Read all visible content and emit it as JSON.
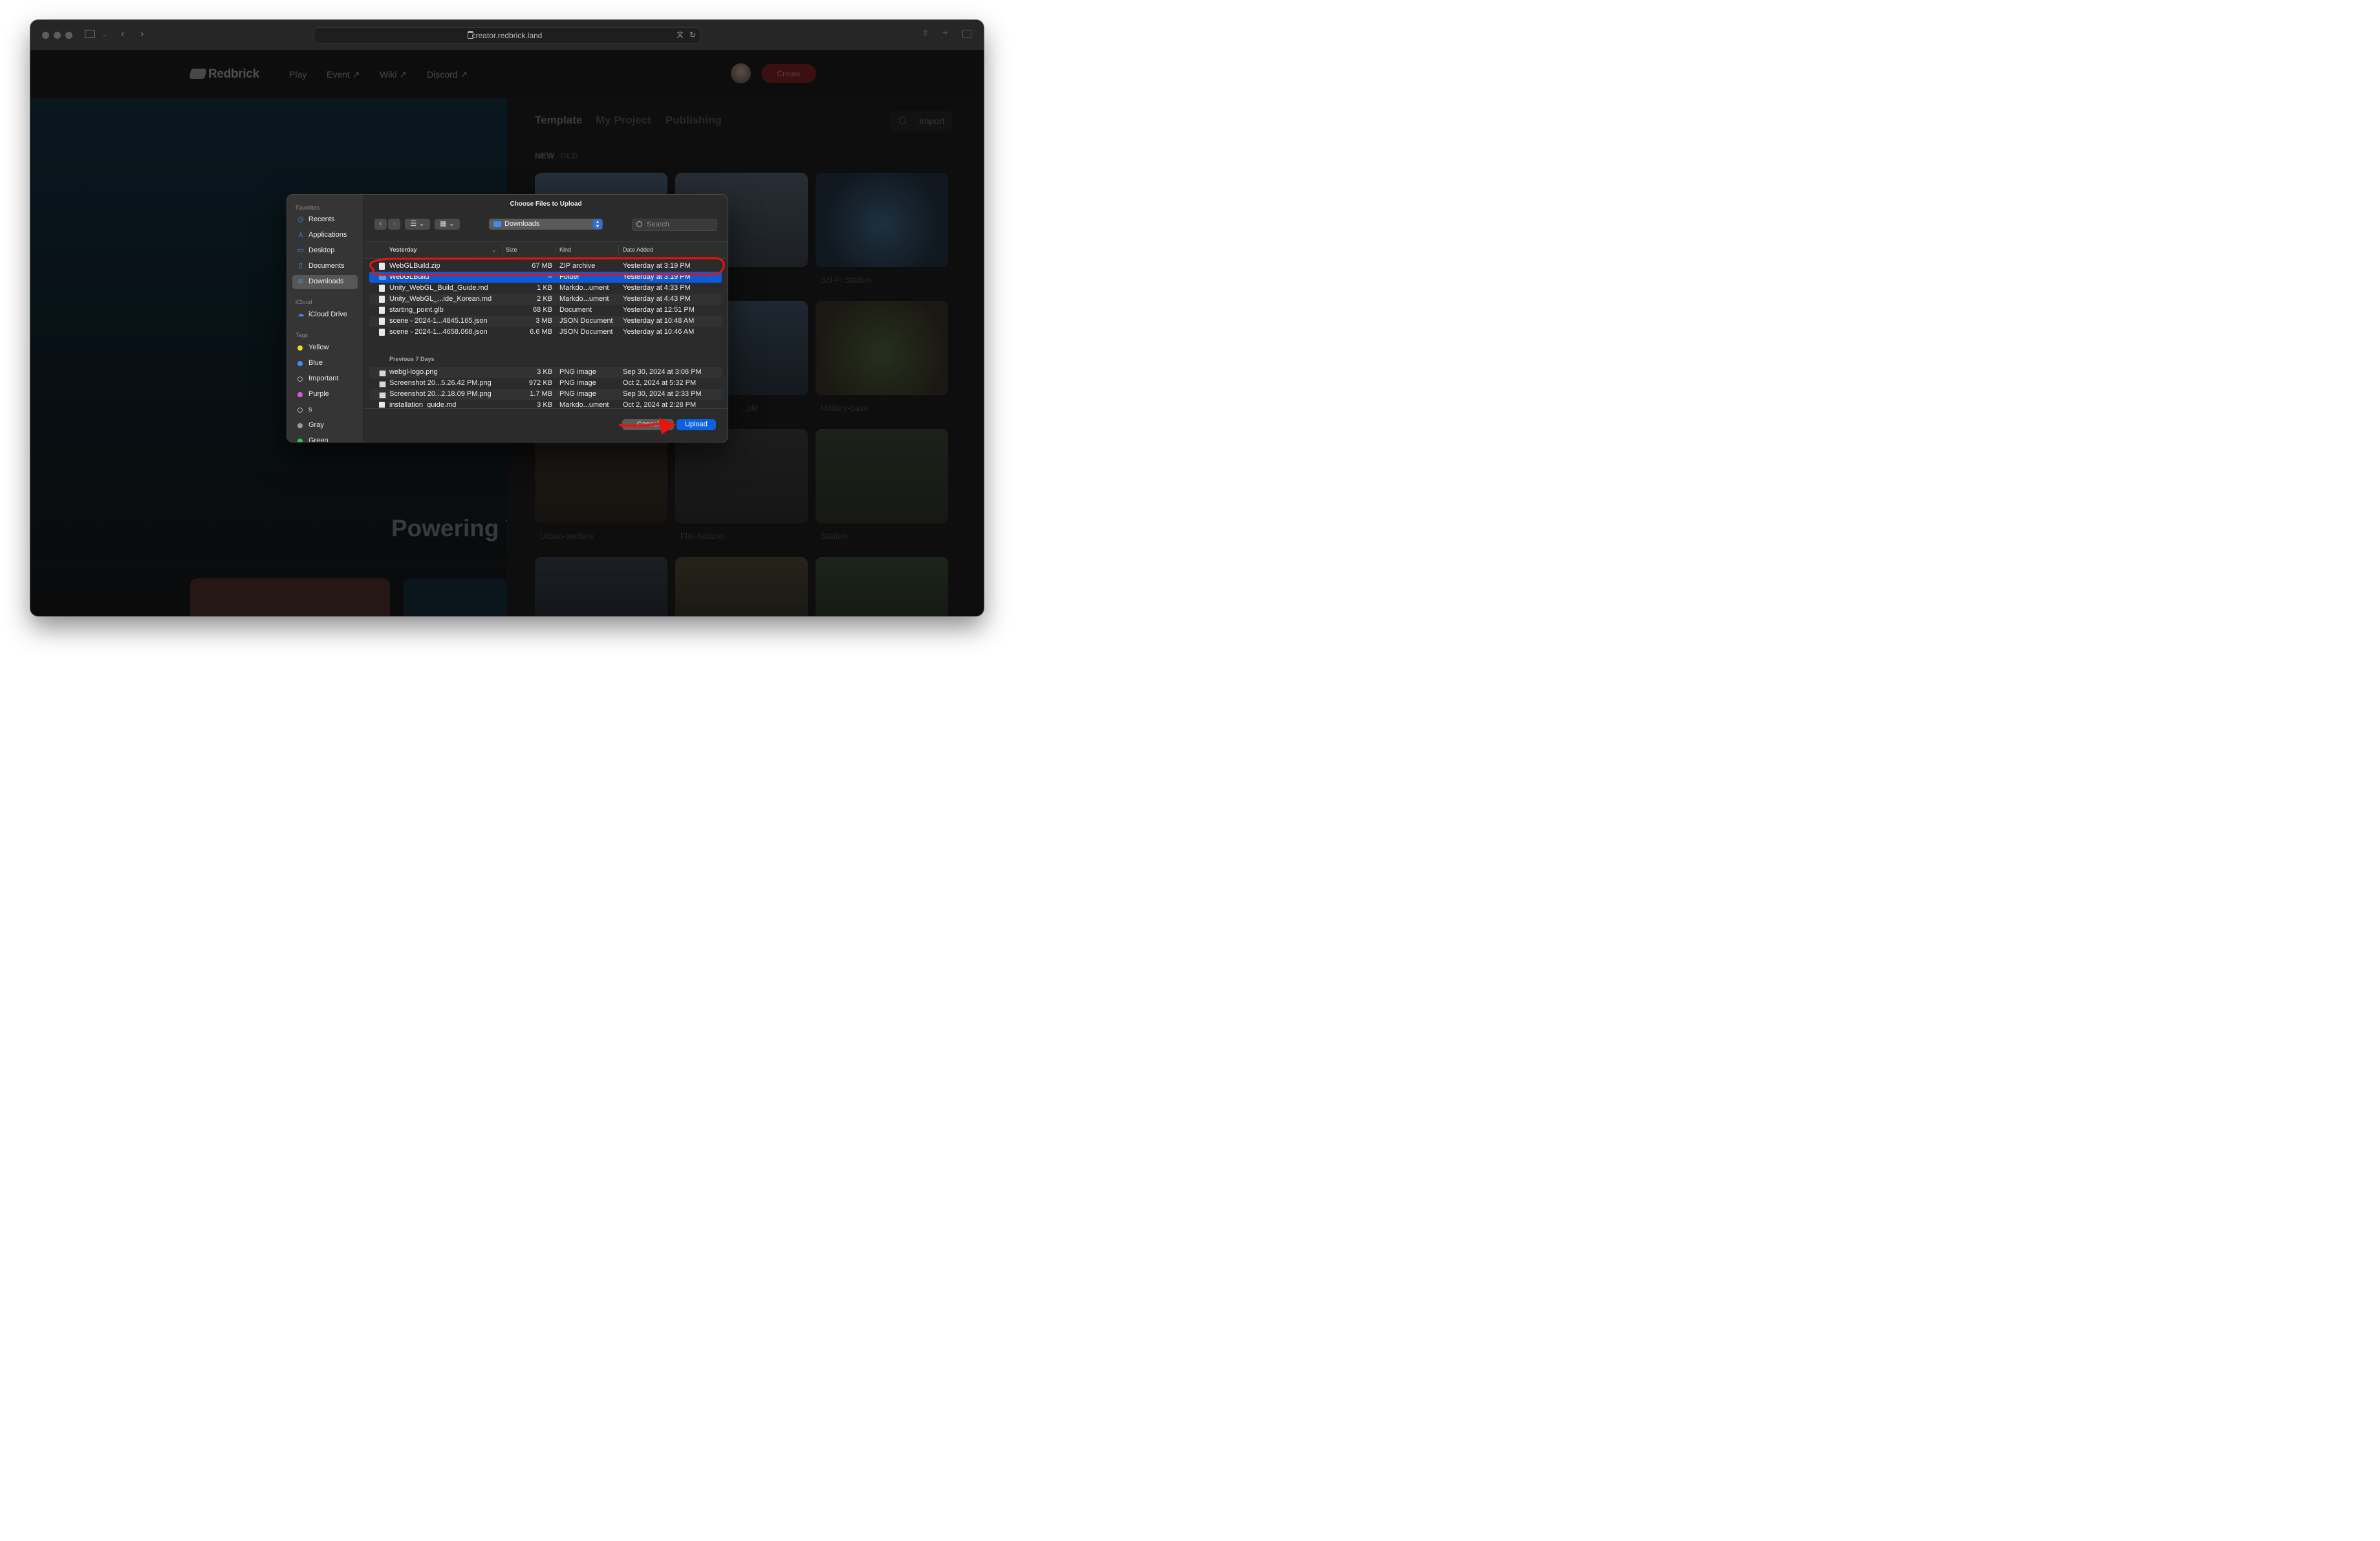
{
  "browser": {
    "url": "creator.redbrick.land"
  },
  "site": {
    "logo": "Redbrick",
    "nav": [
      {
        "label": "Play"
      },
      {
        "label": "Event ↗"
      },
      {
        "label": "Wiki ↗"
      },
      {
        "label": "Discord ↗"
      }
    ],
    "create_label": "Create",
    "hero_title": "Powering Y"
  },
  "panel": {
    "tabs": [
      "Template",
      "My Project",
      "Publishing"
    ],
    "import_label": "Import",
    "sort": [
      "NEW",
      "OLD"
    ],
    "cards": [
      {
        "label": ""
      },
      {
        "label": ""
      },
      {
        "label": "Sci-Fi Station"
      },
      {
        "label": ""
      },
      {
        "label": "…ple"
      },
      {
        "label": "Military-base"
      },
      {
        "label": "Urban-warfare"
      },
      {
        "label": "Flat-horizon"
      },
      {
        "label": "Station"
      }
    ]
  },
  "dialog": {
    "title": "Choose Files to Upload",
    "location": "Downloads",
    "search_placeholder": "Search",
    "sidebar": {
      "favorites_header": "Favorites",
      "favorites": [
        {
          "label": "Recents",
          "icon": "clock-icon"
        },
        {
          "label": "Applications",
          "icon": "applications-icon"
        },
        {
          "label": "Desktop",
          "icon": "desktop-icon"
        },
        {
          "label": "Documents",
          "icon": "document-icon"
        },
        {
          "label": "Downloads",
          "icon": "downloads-icon",
          "selected": true
        }
      ],
      "icloud_header": "iCloud",
      "icloud": [
        {
          "label": "iCloud Drive",
          "icon": "cloud-icon"
        }
      ],
      "tags_header": "Tags",
      "tags": [
        {
          "label": "Yellow",
          "color": "#f4d42c"
        },
        {
          "label": "Blue",
          "color": "#3d8ff0"
        },
        {
          "label": "Important",
          "color": ""
        },
        {
          "label": "Purple",
          "color": "#d45be0"
        },
        {
          "label": "s",
          "color": ""
        },
        {
          "label": "Gray",
          "color": "#9c9c9c"
        },
        {
          "label": "Green",
          "color": "#33c94a"
        }
      ]
    },
    "columns": {
      "name": "Yesterday",
      "size": "Size",
      "kind": "Kind",
      "date": "Date Added"
    },
    "groups": {
      "yesterday": "Yesterday",
      "previous": "Previous 7 Days"
    },
    "files_yesterday": [
      {
        "name": "WebGLBuild.zip",
        "size": "67 MB",
        "kind": "ZIP archive",
        "date": "Yesterday at 3:19 PM",
        "type": "doc"
      },
      {
        "name": "WebGLBuild",
        "size": "--",
        "kind": "Folder",
        "date": "Yesterday at 3:19 PM",
        "type": "folder",
        "selected": true
      },
      {
        "name": "Unity_WebGL_Build_Guide.md",
        "size": "1 KB",
        "kind": "Markdo...ument",
        "date": "Yesterday at 4:33 PM",
        "type": "doc"
      },
      {
        "name": "Unity_WebGL_...ide_Korean.md",
        "size": "2 KB",
        "kind": "Markdo...ument",
        "date": "Yesterday at 4:43 PM",
        "type": "doc"
      },
      {
        "name": "starting_point.glb",
        "size": "68 KB",
        "kind": "Document",
        "date": "Yesterday at 12:51 PM",
        "type": "doc"
      },
      {
        "name": "scene - 2024-1...4845.165.json",
        "size": "3 MB",
        "kind": "JSON Document",
        "date": "Yesterday at 10:48 AM",
        "type": "doc"
      },
      {
        "name": "scene - 2024-1...4658.068.json",
        "size": "6.6 MB",
        "kind": "JSON Document",
        "date": "Yesterday at 10:46 AM",
        "type": "doc"
      }
    ],
    "files_previous": [
      {
        "name": "webgl-logo.png",
        "size": "3 KB",
        "kind": "PNG image",
        "date": "Sep 30, 2024 at 3:08 PM",
        "type": "img"
      },
      {
        "name": "Screenshot 20...5.26.42 PM.png",
        "size": "972 KB",
        "kind": "PNG image",
        "date": "Oct 2, 2024 at 5:32 PM",
        "type": "img"
      },
      {
        "name": "Screenshot 20...2.18.09 PM.png",
        "size": "1.7 MB",
        "kind": "PNG image",
        "date": "Sep 30, 2024 at 2:33 PM",
        "type": "img"
      },
      {
        "name": "installation_guide.md",
        "size": "3 KB",
        "kind": "Markdo...ument",
        "date": "Oct 2, 2024 at 2:28 PM",
        "type": "doc"
      }
    ],
    "cancel_label": "Cancel",
    "upload_label": "Upload"
  },
  "annotation_color": "#e8140e"
}
